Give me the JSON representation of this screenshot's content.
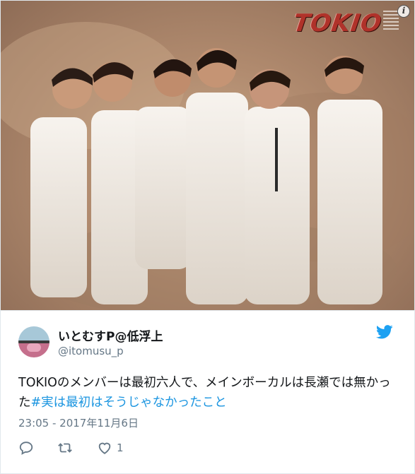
{
  "photo": {
    "logo_text": "TOKIO",
    "info_icon": "info-icon"
  },
  "tweet": {
    "display_name": "いとむすP@低浮上",
    "handle": "@itomusu_p",
    "text_plain": "TOKIOのメンバーは最初六人で、メインボーカルは長瀬では無かった",
    "hashtag": "#実は最初はそうじゃなかったこと",
    "timestamp": "23:05 - 2017年11月6日",
    "like_count": "1"
  },
  "icons": {
    "brand": "twitter-bird-icon",
    "reply": "reply-icon",
    "retweet": "retweet-icon",
    "like": "heart-icon"
  },
  "colors": {
    "brand_blue": "#1da1f2",
    "hashtag_blue": "#1b95e0",
    "muted_text": "#657786",
    "logo_red": "#b0322a"
  }
}
